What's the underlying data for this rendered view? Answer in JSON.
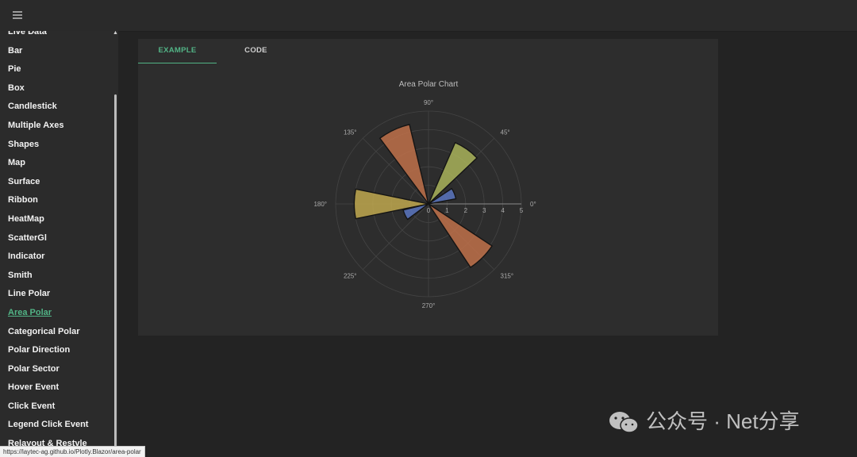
{
  "sidebar": {
    "items": [
      {
        "label": "Live Data"
      },
      {
        "label": "Bar"
      },
      {
        "label": "Pie"
      },
      {
        "label": "Box"
      },
      {
        "label": "Candlestick"
      },
      {
        "label": "Multiple Axes"
      },
      {
        "label": "Shapes"
      },
      {
        "label": "Map"
      },
      {
        "label": "Surface"
      },
      {
        "label": "Ribbon"
      },
      {
        "label": "HeatMap"
      },
      {
        "label": "ScatterGl"
      },
      {
        "label": "Indicator"
      },
      {
        "label": "Smith"
      },
      {
        "label": "Line Polar"
      },
      {
        "label": "Area Polar",
        "active": true
      },
      {
        "label": "Categorical Polar"
      },
      {
        "label": "Polar Direction"
      },
      {
        "label": "Polar Sector"
      },
      {
        "label": "Hover Event"
      },
      {
        "label": "Click Event"
      },
      {
        "label": "Legend Click Event"
      },
      {
        "label": "Relayout & Restyle"
      }
    ]
  },
  "tabs": {
    "example": "EXAMPLE",
    "code": "CODE",
    "active": "example"
  },
  "status_url": "https://laytec-ag.github.io/Plotly.Blazor/area-polar",
  "watermark": "公众号 · Net分享",
  "chart_data": {
    "type": "area-polar",
    "title": "Area Polar Chart",
    "angular_ticks": [
      "0°",
      "45°",
      "90°",
      "135°",
      "180°",
      "225°",
      "270°",
      "315°"
    ],
    "radial_ticks": [
      "0",
      "1",
      "2",
      "3",
      "4",
      "5"
    ],
    "radial_range": [
      0,
      5
    ],
    "grid": true,
    "series": [
      {
        "color": "#c0714a",
        "r": [
          4.4
        ],
        "theta": [
          115
        ],
        "width_deg": 23
      },
      {
        "color": "#a9b35b",
        "r": [
          3.6
        ],
        "theta": [
          55
        ],
        "width_deg": 23
      },
      {
        "color": "#5a76c0",
        "r": [
          1.5
        ],
        "theta": [
          22
        ],
        "width_deg": 23
      },
      {
        "color": "#c0a84f",
        "r": [
          4
        ],
        "theta": [
          180
        ],
        "width_deg": 23
      },
      {
        "color": "#5a76c0",
        "r": [
          1.4
        ],
        "theta": [
          205
        ],
        "width_deg": 23
      },
      {
        "color": "#c0714a",
        "r": [
          4.1
        ],
        "theta": [
          315
        ],
        "width_deg": 23
      }
    ]
  }
}
